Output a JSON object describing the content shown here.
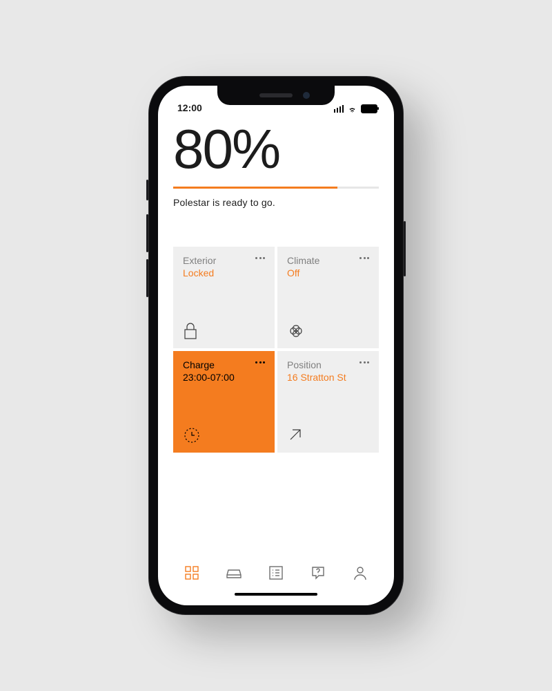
{
  "statusbar": {
    "time": "12:00"
  },
  "battery": {
    "percent_label": "80%",
    "percent": 80,
    "status_text": "Polestar is ready to go."
  },
  "tiles": {
    "exterior": {
      "title": "Exterior",
      "value": "Locked"
    },
    "climate": {
      "title": "Climate",
      "value": "Off"
    },
    "charge": {
      "title": "Charge",
      "value": "23:00-07:00"
    },
    "position": {
      "title": "Position",
      "value": "16 Stratton St"
    }
  },
  "colors": {
    "accent": "#f47c1f"
  }
}
